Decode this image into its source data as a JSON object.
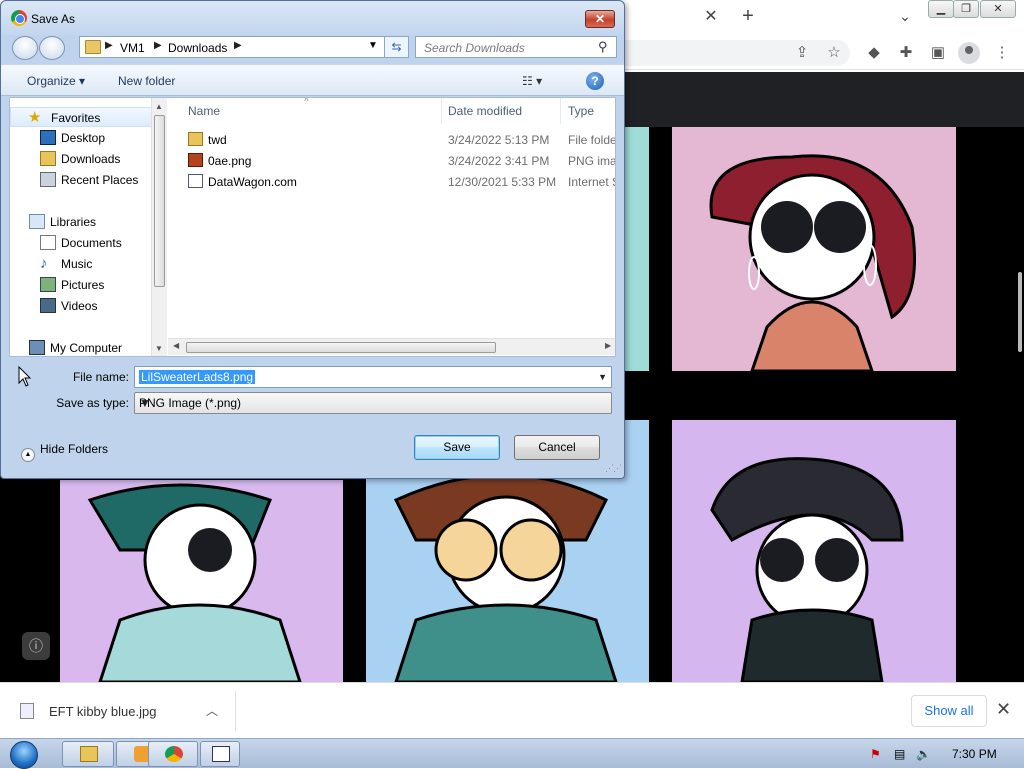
{
  "dialog": {
    "title": "Save As",
    "close_label": "✕",
    "breadcrumb": [
      "VM1",
      "Downloads"
    ],
    "search_placeholder": "Search Downloads",
    "commands": {
      "organize": "Organize ▾",
      "new_folder": "New folder",
      "view": "☷ ▾",
      "help": "?"
    },
    "nav": {
      "favorites_label": "Favorites",
      "favorites": [
        "Desktop",
        "Downloads",
        "Recent Places"
      ],
      "libraries_label": "Libraries",
      "libraries": [
        "Documents",
        "Music",
        "Pictures",
        "Videos"
      ],
      "computer_label": "My Computer"
    },
    "columns": [
      "Name",
      "Date modified",
      "Type"
    ],
    "files": [
      {
        "name": "twd",
        "date": "3/24/2022 5:13 PM",
        "type": "File folder",
        "icon": "folder-icon"
      },
      {
        "name": "0ae.png",
        "date": "3/24/2022 3:41 PM",
        "type": "PNG image",
        "icon": "image-file-icon"
      },
      {
        "name": "DataWagon.com",
        "date": "12/30/2021 5:33 PM",
        "type": "Internet Shortcut",
        "icon": "shortcut-icon"
      }
    ],
    "file_name_label": "File name:",
    "file_name_value": "LilSweaterLads8.png",
    "save_type_label": "Save as type:",
    "save_type_value": "PNG Image (*.png)",
    "hide_folders": "Hide Folders",
    "save": "Save",
    "cancel": "Cancel"
  },
  "downloads": {
    "item_name": "EFT kibby blue.jpg",
    "show_all": "Show all"
  },
  "taskbar": {
    "time": "7:30 PM"
  },
  "colors": {
    "panel_pink": "#e4b8d2",
    "panel_teal": "#9edcd8",
    "panel_purple": "#d9b8ee",
    "panel_blue": "#a9d1f2",
    "panel_violet": "#d5b6ef"
  }
}
